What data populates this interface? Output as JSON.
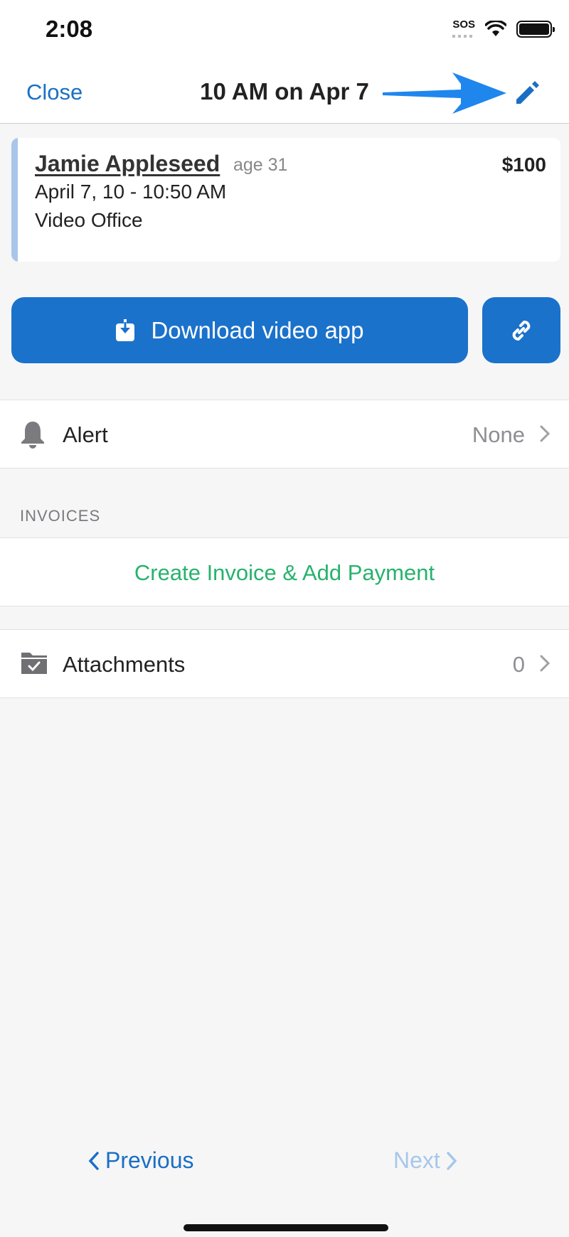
{
  "status": {
    "time": "2:08",
    "sos": "SOS"
  },
  "nav": {
    "close_label": "Close",
    "title": "10 AM on Apr 7"
  },
  "appointment": {
    "client_name": "Jamie Appleseed",
    "age": "age 31",
    "price": "$100",
    "time_range": "April 7, 10 - 10:50 AM",
    "location": "Video Office"
  },
  "actions": {
    "download_label": "Download video app"
  },
  "alert": {
    "label": "Alert",
    "value": "None"
  },
  "invoices": {
    "section_header": "INVOICES",
    "create_label": "Create Invoice & Add Payment"
  },
  "attachments": {
    "label": "Attachments",
    "count": "0"
  },
  "footer": {
    "previous_label": "Previous",
    "next_label": "Next"
  },
  "colors": {
    "accent": "#1a72cb",
    "link": "#1a6fc4",
    "success": "#27b26d",
    "disabled": "#a7c7ea",
    "card_stripe": "#a9c6ea"
  }
}
